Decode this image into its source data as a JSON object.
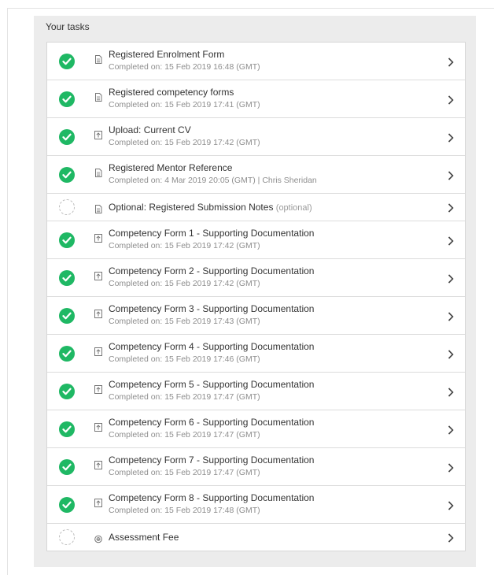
{
  "panel": {
    "title": "Your tasks"
  },
  "colors": {
    "done": "#1fb864",
    "pending_border": "#bdbdbd",
    "panel_bg": "#ececec"
  },
  "tasks": [
    {
      "title": "Registered Enrolment Form",
      "status": "completed",
      "icon": "form-icon",
      "subtitle": "Completed on: 15 Feb 2019 16:48 (GMT)"
    },
    {
      "title": "Registered competency forms",
      "status": "completed",
      "icon": "form-icon",
      "subtitle": "Completed on: 15 Feb 2019 17:41 (GMT)"
    },
    {
      "title": "Upload: Current CV",
      "status": "completed",
      "icon": "upload-icon",
      "subtitle": "Completed on: 15 Feb 2019 17:42 (GMT)"
    },
    {
      "title": "Registered Mentor Reference",
      "status": "completed",
      "icon": "form-icon",
      "subtitle": "Completed on: 4 Mar 2019 20:05 (GMT) | Chris Sheridan"
    },
    {
      "title": "Optional: Registered Submission Notes",
      "status": "pending",
      "icon": "form-icon",
      "optional": "(optional)",
      "subtitle": ""
    },
    {
      "title": "Competency Form 1 - Supporting Documentation",
      "status": "completed",
      "icon": "upload-icon",
      "subtitle": "Completed on: 15 Feb 2019 17:42 (GMT)"
    },
    {
      "title": "Competency Form 2 - Supporting Documentation",
      "status": "completed",
      "icon": "upload-icon",
      "subtitle": "Completed on: 15 Feb 2019 17:42 (GMT)"
    },
    {
      "title": "Competency Form 3 - Supporting Documentation",
      "status": "completed",
      "icon": "upload-icon",
      "subtitle": "Completed on: 15 Feb 2019 17:43 (GMT)"
    },
    {
      "title": "Competency Form 4 - Supporting Documentation",
      "status": "completed",
      "icon": "upload-icon",
      "subtitle": "Completed on: 15 Feb 2019 17:46 (GMT)"
    },
    {
      "title": "Competency Form 5 - Supporting Documentation",
      "status": "completed",
      "icon": "upload-icon",
      "subtitle": "Completed on: 15 Feb 2019 17:47 (GMT)"
    },
    {
      "title": "Competency Form 6 - Supporting Documentation",
      "status": "completed",
      "icon": "upload-icon",
      "subtitle": "Completed on: 15 Feb 2019 17:47 (GMT)"
    },
    {
      "title": "Competency Form 7 - Supporting Documentation",
      "status": "completed",
      "icon": "upload-icon",
      "subtitle": "Completed on: 15 Feb 2019 17:47 (GMT)"
    },
    {
      "title": "Competency Form 8 - Supporting Documentation",
      "status": "completed",
      "icon": "upload-icon",
      "subtitle": "Completed on: 15 Feb 2019 17:48 (GMT)"
    },
    {
      "title": "Assessment Fee",
      "status": "pending",
      "icon": "payment-icon",
      "subtitle": ""
    }
  ]
}
